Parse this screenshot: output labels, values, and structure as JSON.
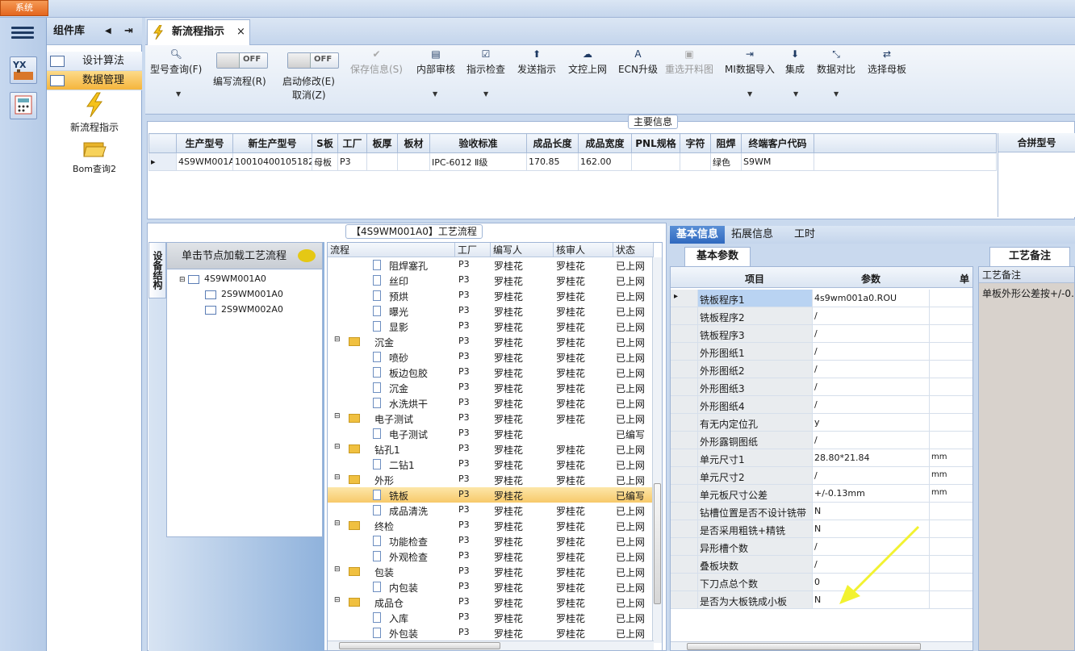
{
  "system_button": "系统",
  "component_panel": {
    "title": "组件库",
    "items": [
      {
        "label": "设计算法",
        "selected": false
      },
      {
        "label": "数据管理",
        "selected": true
      }
    ],
    "big_items": [
      {
        "label": "新流程指示",
        "icon": "lightning-icon"
      },
      {
        "label": "Bom查询2",
        "icon": "folder-open-icon"
      }
    ]
  },
  "document_tab": {
    "label": "新流程指示",
    "close": "×"
  },
  "toolbar": {
    "model_query": "型号查询(F)",
    "edit_flow": "编写流程(R)",
    "edit_flow_toggle": "OFF",
    "start_modify": "启动修改(E)",
    "start_modify_toggle": "OFF",
    "cancel": "取消(Z)",
    "save_info": "保存信息(S)",
    "internal_review": "内部审核",
    "instruction_check": "指示检查",
    "send_instruction": "发送指示",
    "doc_upload": "文控上网",
    "ecn_upgrade": "ECN升级",
    "reselect_map": "重选开料图",
    "mi_import": "MI数据导入",
    "integrate": "集成",
    "data_compare": "数据对比",
    "select_master": "选择母板"
  },
  "main_info": {
    "group_title": "主要信息",
    "columns": [
      "生产型号",
      "新生产型号",
      "S板",
      "工厂",
      "板厚",
      "板材",
      "验收标准",
      "成品长度",
      "成品宽度",
      "PNL规格",
      "字符",
      "阻焊",
      "终端客户代码"
    ],
    "row": [
      "4S9WM001A0",
      "10010400105182",
      "母板",
      "P3",
      "",
      "",
      "IPC-6012 Ⅱ级",
      "170.85",
      "162.00",
      "",
      "",
      "绿色",
      "S9WM"
    ],
    "merge_title": "合拼型号"
  },
  "process_title": "【4S9WM001A0】工艺流程",
  "left_tree": {
    "side_tab": "设备结构",
    "header": "单击节点加载工艺流程",
    "nodes": [
      "4S9WM001A0",
      "2S9WM001A0",
      "2S9WM002A0"
    ]
  },
  "flow": {
    "columns": [
      "流程",
      "工厂",
      "编写人",
      "核审人",
      "状态"
    ],
    "rows": [
      {
        "name": "阻焊塞孔",
        "level": 2,
        "folder": false,
        "factory": "P3",
        "writer": "罗桂花",
        "reviewer": "罗桂花",
        "status": "已上网"
      },
      {
        "name": "丝印",
        "level": 2,
        "folder": false,
        "factory": "P3",
        "writer": "罗桂花",
        "reviewer": "罗桂花",
        "status": "已上网"
      },
      {
        "name": "预烘",
        "level": 2,
        "folder": false,
        "factory": "P3",
        "writer": "罗桂花",
        "reviewer": "罗桂花",
        "status": "已上网"
      },
      {
        "name": "曝光",
        "level": 2,
        "folder": false,
        "factory": "P3",
        "writer": "罗桂花",
        "reviewer": "罗桂花",
        "status": "已上网"
      },
      {
        "name": "显影",
        "level": 2,
        "folder": false,
        "factory": "P3",
        "writer": "罗桂花",
        "reviewer": "罗桂花",
        "status": "已上网"
      },
      {
        "name": "沉金",
        "level": 1,
        "folder": true,
        "factory": "P3",
        "writer": "罗桂花",
        "reviewer": "罗桂花",
        "status": "已上网"
      },
      {
        "name": "喷砂",
        "level": 2,
        "folder": false,
        "factory": "P3",
        "writer": "罗桂花",
        "reviewer": "罗桂花",
        "status": "已上网"
      },
      {
        "name": "板边包胶",
        "level": 2,
        "folder": false,
        "factory": "P3",
        "writer": "罗桂花",
        "reviewer": "罗桂花",
        "status": "已上网"
      },
      {
        "name": "沉金",
        "level": 2,
        "folder": false,
        "factory": "P3",
        "writer": "罗桂花",
        "reviewer": "罗桂花",
        "status": "已上网"
      },
      {
        "name": "水洗烘干",
        "level": 2,
        "folder": false,
        "factory": "P3",
        "writer": "罗桂花",
        "reviewer": "罗桂花",
        "status": "已上网"
      },
      {
        "name": "电子测试",
        "level": 1,
        "folder": true,
        "factory": "P3",
        "writer": "罗桂花",
        "reviewer": "罗桂花",
        "status": "已上网"
      },
      {
        "name": "电子测试",
        "level": 2,
        "folder": false,
        "factory": "P3",
        "writer": "罗桂花",
        "reviewer": "",
        "status": "已编写"
      },
      {
        "name": "钻孔1",
        "level": 1,
        "folder": true,
        "factory": "P3",
        "writer": "罗桂花",
        "reviewer": "罗桂花",
        "status": "已上网"
      },
      {
        "name": "二钻1",
        "level": 2,
        "folder": false,
        "factory": "P3",
        "writer": "罗桂花",
        "reviewer": "罗桂花",
        "status": "已上网"
      },
      {
        "name": "外形",
        "level": 1,
        "folder": true,
        "factory": "P3",
        "writer": "罗桂花",
        "reviewer": "罗桂花",
        "status": "已上网"
      },
      {
        "name": "铣板",
        "level": 2,
        "folder": false,
        "factory": "P3",
        "writer": "罗桂花",
        "reviewer": "",
        "status": "已编写",
        "selected": true
      },
      {
        "name": "成品清洗",
        "level": 2,
        "folder": false,
        "factory": "P3",
        "writer": "罗桂花",
        "reviewer": "罗桂花",
        "status": "已上网"
      },
      {
        "name": "终检",
        "level": 1,
        "folder": true,
        "factory": "P3",
        "writer": "罗桂花",
        "reviewer": "罗桂花",
        "status": "已上网"
      },
      {
        "name": "功能检查",
        "level": 2,
        "folder": false,
        "factory": "P3",
        "writer": "罗桂花",
        "reviewer": "罗桂花",
        "status": "已上网"
      },
      {
        "name": "外观检查",
        "level": 2,
        "folder": false,
        "factory": "P3",
        "writer": "罗桂花",
        "reviewer": "罗桂花",
        "status": "已上网"
      },
      {
        "name": "包装",
        "level": 1,
        "folder": true,
        "factory": "P3",
        "writer": "罗桂花",
        "reviewer": "罗桂花",
        "status": "已上网"
      },
      {
        "name": "内包装",
        "level": 2,
        "folder": false,
        "factory": "P3",
        "writer": "罗桂花",
        "reviewer": "罗桂花",
        "status": "已上网"
      },
      {
        "name": "成品仓",
        "level": 1,
        "folder": true,
        "factory": "P3",
        "writer": "罗桂花",
        "reviewer": "罗桂花",
        "status": "已上网"
      },
      {
        "name": "入库",
        "level": 2,
        "folder": false,
        "factory": "P3",
        "writer": "罗桂花",
        "reviewer": "罗桂花",
        "status": "已上网"
      },
      {
        "name": "外包装",
        "level": 2,
        "folder": false,
        "factory": "P3",
        "writer": "罗桂花",
        "reviewer": "罗桂花",
        "status": "已上网"
      }
    ]
  },
  "right_tabs": [
    "基本信息",
    "拓展信息",
    "工时"
  ],
  "params": {
    "subtab": "基本参数",
    "columns": [
      "项目",
      "参数",
      "单"
    ],
    "rows": [
      {
        "item": "铣板程序1",
        "value": "4s9wm001a0.ROU",
        "unit": "",
        "selected": true
      },
      {
        "item": "铣板程序2",
        "value": "/",
        "unit": ""
      },
      {
        "item": "铣板程序3",
        "value": "/",
        "unit": ""
      },
      {
        "item": "外形图纸1",
        "value": "/",
        "unit": ""
      },
      {
        "item": "外形图纸2",
        "value": "/",
        "unit": ""
      },
      {
        "item": "外形图纸3",
        "value": "/",
        "unit": ""
      },
      {
        "item": "外形图纸4",
        "value": "/",
        "unit": ""
      },
      {
        "item": "有无内定位孔",
        "value": "y",
        "unit": ""
      },
      {
        "item": "外形露铜图纸",
        "value": "/",
        "unit": ""
      },
      {
        "item": "单元尺寸1",
        "value": "28.80*21.84",
        "unit": "mm"
      },
      {
        "item": "单元尺寸2",
        "value": "/",
        "unit": "mm"
      },
      {
        "item": "单元板尺寸公差",
        "value": "+/-0.13mm",
        "unit": "mm"
      },
      {
        "item": "钻槽位置是否不设计铣带",
        "value": "N",
        "unit": ""
      },
      {
        "item": "是否采用粗铣+精铣",
        "value": "N",
        "unit": ""
      },
      {
        "item": "异形槽个数",
        "value": "/",
        "unit": ""
      },
      {
        "item": "叠板块数",
        "value": "/",
        "unit": ""
      },
      {
        "item": "下刀点总个数",
        "value": "0",
        "unit": ""
      },
      {
        "item": "是否为大板铣成小板",
        "value": "N",
        "unit": ""
      }
    ]
  },
  "process_note": {
    "tab": "工艺备注",
    "header": "工艺备注",
    "text": "单板外形公差按+/-0."
  },
  "colors": {
    "accent": "#2f69bf",
    "selected_row": "#f7c96a",
    "arrow": "#f2f230"
  }
}
